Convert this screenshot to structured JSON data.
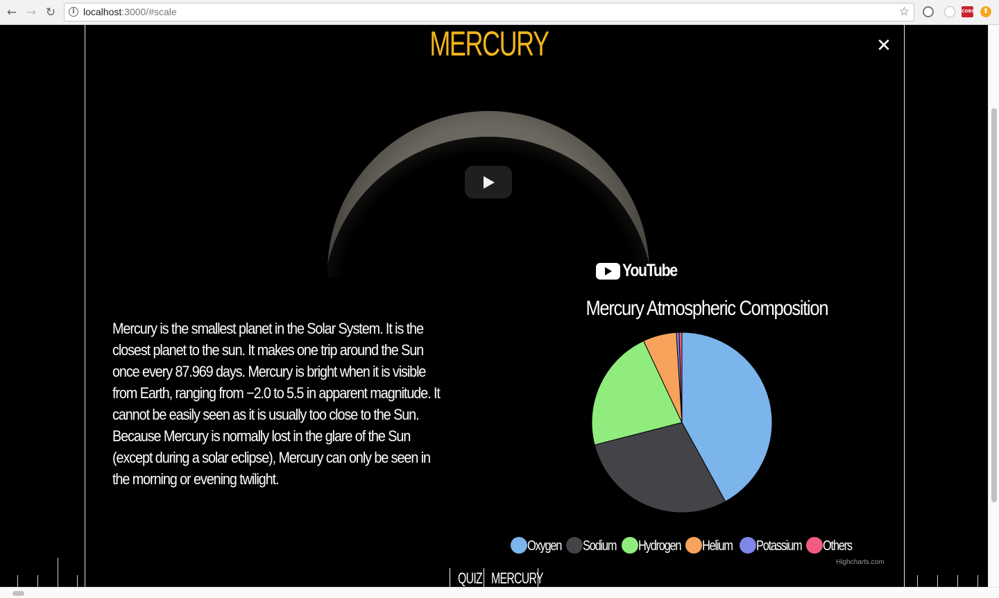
{
  "browser": {
    "url_host": "localhost",
    "url_rest": ":3000/#scale",
    "icons": [
      "back-arrow-icon",
      "forward-arrow-icon",
      "reload-icon",
      "info-icon",
      "star-icon",
      "gear-extension-icon",
      "circle-extension-icon",
      "cors-extension-icon",
      "orange-extension-icon"
    ],
    "cors_label": "CORS"
  },
  "page": {
    "planet_name": "MERCURY",
    "close_symbol": "✕",
    "description": "Mercury is the smallest planet in the Solar System. It is the closest planet to the sun. It makes one trip around the Sun once every 87.969 days. Mercury is bright when it is visible from Earth, ranging from −2.0 to 5.5 in apparent magnitude. It cannot be easily seen as it is usually too close to the Sun. Because Mercury is normally lost in the glare of the Sun (except during a solar eclipse), Mercury can only be seen in the morning or evening twilight.",
    "youtube_label": "YouTube",
    "nav": {
      "quiz": "QUIZ",
      "planet": "MERCURY"
    }
  },
  "chart_data": {
    "type": "pie",
    "title": "Mercury Atmospheric Composition",
    "credits": "Highcharts.com",
    "legend_position": "bottom",
    "series": [
      {
        "name": "Oxygen",
        "value": 42.0,
        "color": "#7cb5ec"
      },
      {
        "name": "Sodium",
        "value": 29.0,
        "color": "#434348"
      },
      {
        "name": "Hydrogen",
        "value": 22.0,
        "color": "#90ed7d"
      },
      {
        "name": "Helium",
        "value": 6.0,
        "color": "#f7a35c"
      },
      {
        "name": "Potassium",
        "value": 0.5,
        "color": "#8085e9"
      },
      {
        "name": "Others",
        "value": 0.5,
        "color": "#f15c80"
      }
    ]
  }
}
